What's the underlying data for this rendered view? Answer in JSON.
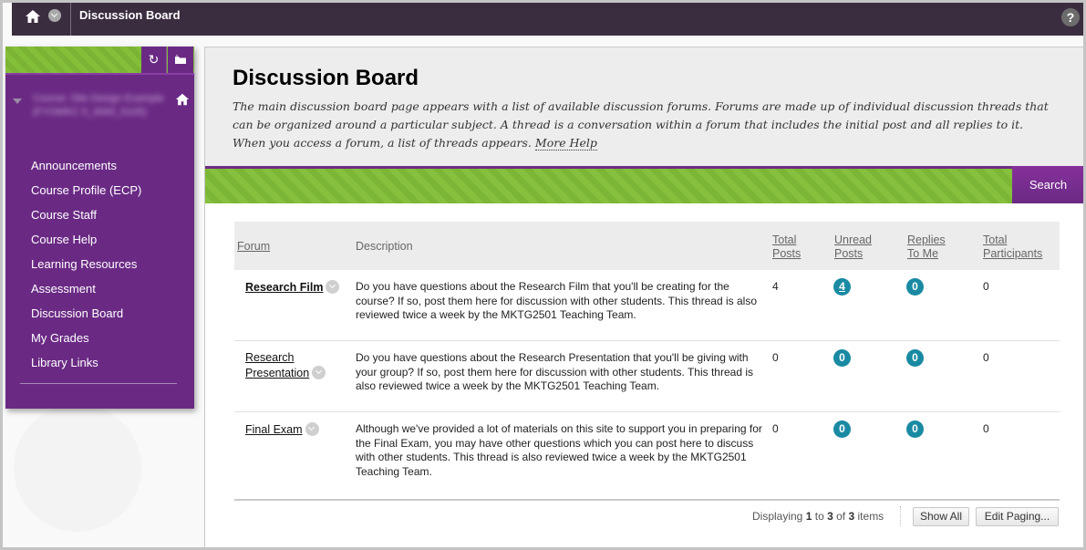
{
  "topbar": {
    "title": "Discussion Board",
    "home_icon": "home-icon",
    "menu_icon": "chevron-down-icon",
    "help_label": "?"
  },
  "sidebar": {
    "course_name": "Course: Site Design Example (FYOMKC 5_3000_5105)",
    "refresh_icon": "refresh-icon",
    "folder_icon": "folder-icon",
    "items": [
      {
        "label": "Announcements"
      },
      {
        "label": "Course Profile (ECP)"
      },
      {
        "label": "Course Staff"
      },
      {
        "label": "Course Help"
      },
      {
        "label": "Learning Resources"
      },
      {
        "label": "Assessment"
      },
      {
        "label": "Discussion Board"
      },
      {
        "label": "My Grades"
      },
      {
        "label": "Library Links"
      }
    ]
  },
  "page": {
    "title": "Discussion Board",
    "description": "The main discussion board page appears with a list of available discussion forums. Forums are made up of individual discussion threads that can be organized around a particular subject. A thread is a conversation within a forum that includes the initial post and all replies to it. When you access a forum, a list of threads appears.",
    "more_help": "More Help",
    "search_label": "Search"
  },
  "table": {
    "headers": {
      "forum": "Forum",
      "description": "Description",
      "total_posts": [
        "Total",
        "Posts"
      ],
      "unread_posts": [
        "Unread",
        "Posts"
      ],
      "replies_to_me": [
        "Replies",
        "To Me"
      ],
      "total_participants": [
        "Total",
        "Participants"
      ]
    },
    "rows": [
      {
        "forum": "Research Film",
        "forum_lines": [
          "Research Film"
        ],
        "description": "Do you have questions about the Research Film that you'll be creating for the course? If so, post them here for discussion with other students. This thread is also reviewed twice a week by the MKTG2501 Teaching Team.",
        "total_posts": "4",
        "unread_posts": "4",
        "replies_to_me": "0",
        "total_participants": "0"
      },
      {
        "forum": "Research Presentation",
        "forum_lines": [
          "Research",
          "Presentation"
        ],
        "description": "Do you have questions about the Research Presentation that you'll be giving with your group? If so, post them here for discussion with other students. This thread is also reviewed twice a week by the MKTG2501 Teaching Team.",
        "total_posts": "0",
        "unread_posts": "0",
        "replies_to_me": "0",
        "total_participants": "0"
      },
      {
        "forum": "Final Exam",
        "forum_lines": [
          "Final Exam"
        ],
        "description": "Although we've provided a lot of materials on this site to support you in preparing for the Final Exam, you may have other questions which you can post here to discuss with other students. This thread is also reviewed twice a week by the MKTG2501 Teaching Team.",
        "total_posts": "0",
        "unread_posts": "0",
        "replies_to_me": "0",
        "total_participants": "0"
      }
    ]
  },
  "paging": {
    "prefix": "Displaying",
    "from": "1",
    "to_word": "to",
    "to": "3",
    "of_word": "of",
    "total": "3",
    "suffix": "items",
    "show_all": "Show All",
    "edit_paging": "Edit Paging..."
  },
  "colors": {
    "topbar": "#3b2d40",
    "brand_purple": "#6a2a84",
    "accent_green": "#84bf3a",
    "badge_teal": "#1a8aa3"
  }
}
